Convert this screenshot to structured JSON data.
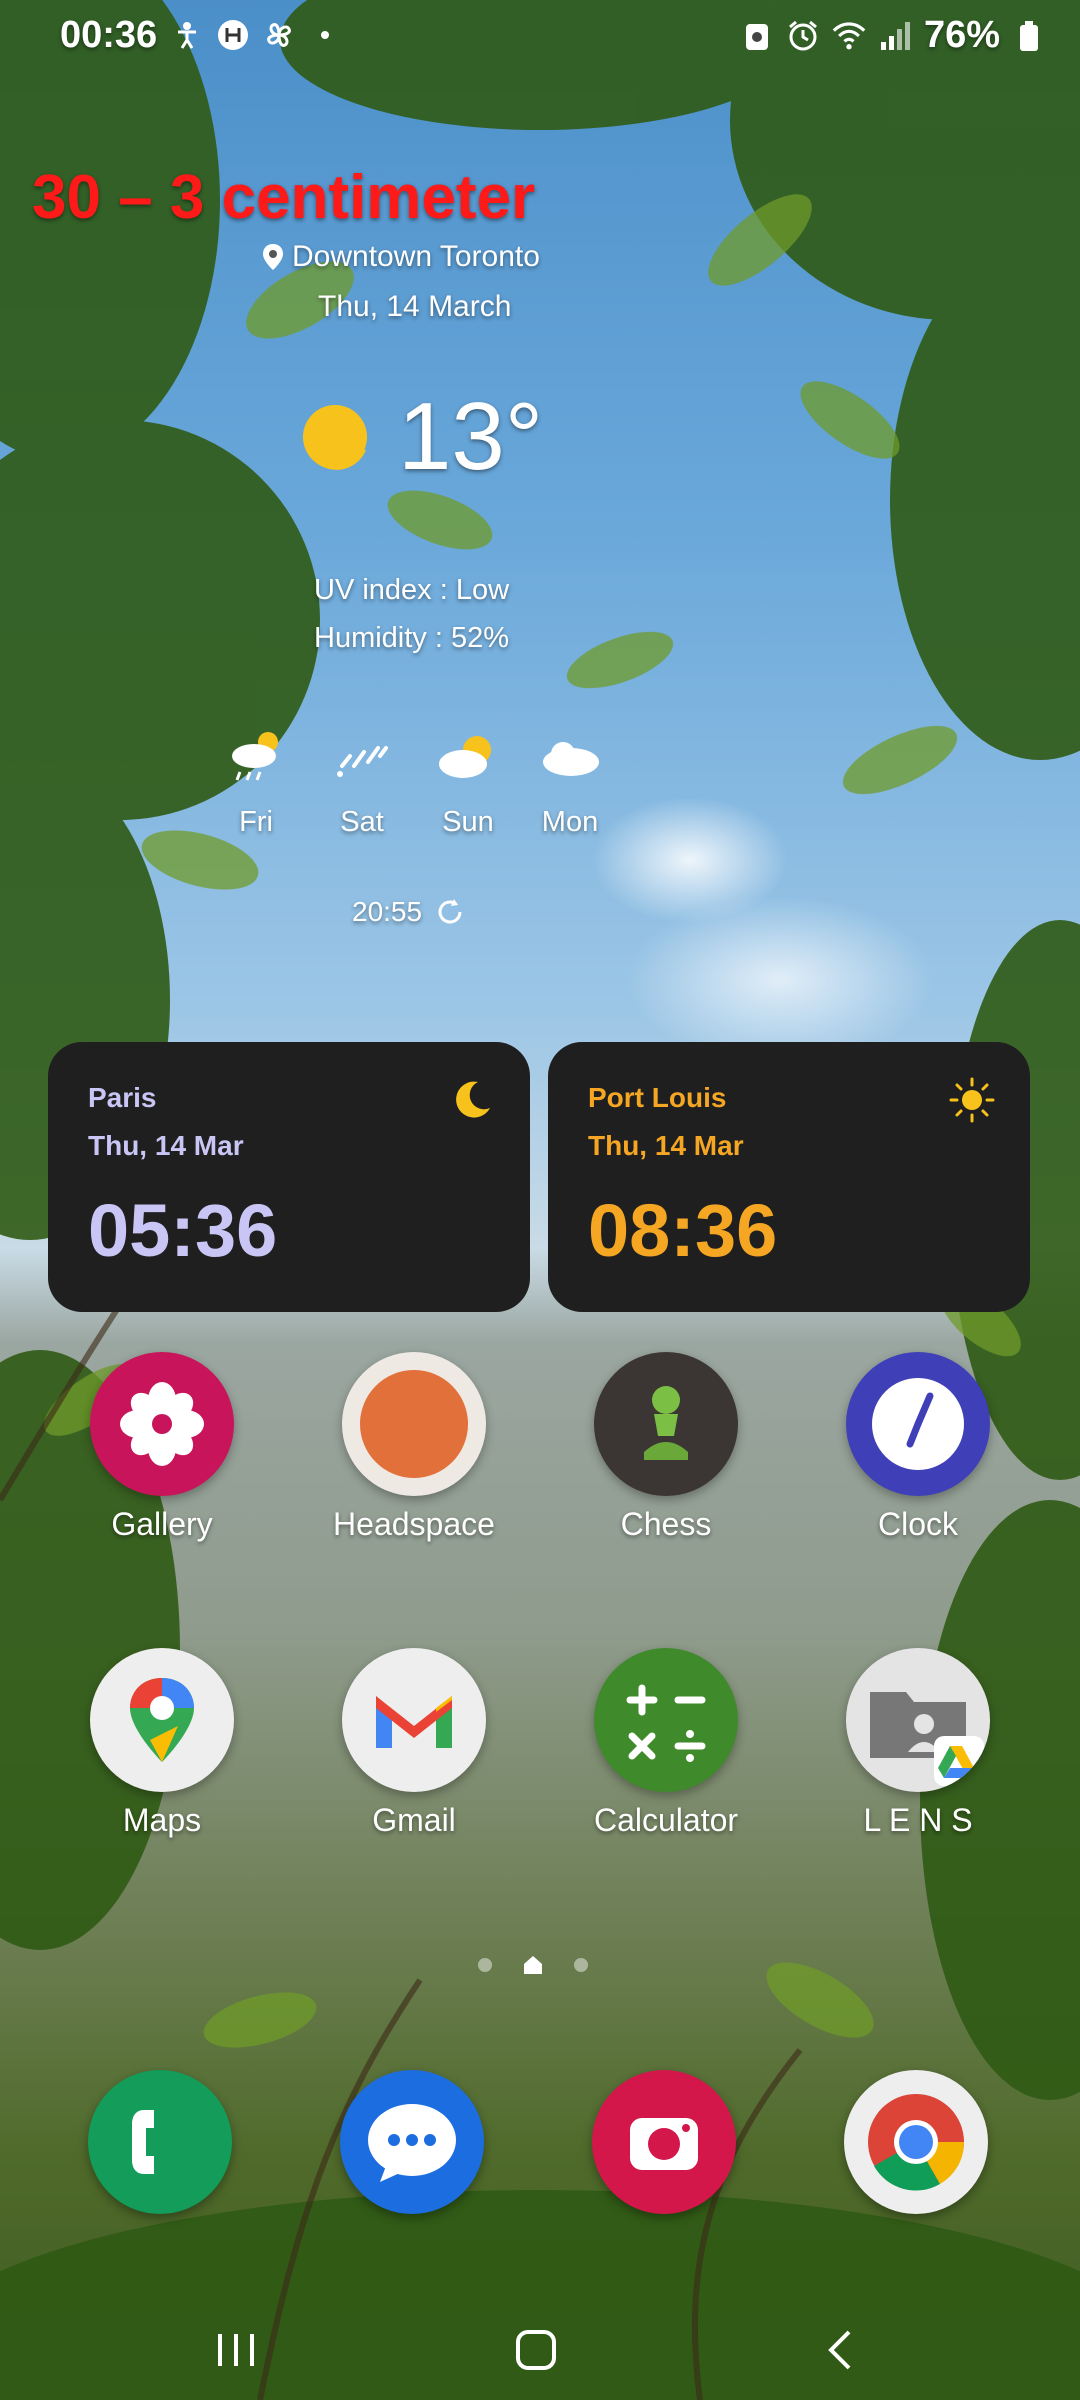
{
  "status_bar": {
    "time": "00:36",
    "battery_percent": "76%",
    "left_icons": [
      "accessibility-icon",
      "hotspot-icon",
      "fan-icon",
      "dot-icon"
    ],
    "right_icons": [
      "alarm-icon",
      "wifi-icon",
      "signal-icon",
      "battery-icon"
    ]
  },
  "weather": {
    "overlay_text": "30 – 3 centimeter",
    "location": "Downtown Toronto",
    "date": "Thu, 14 March",
    "temperature": "13°",
    "uv_index": "UV index : Low",
    "humidity": "Humidity : 52%",
    "forecast": [
      {
        "day": "Fri",
        "icon": "rain-cloud-sun-icon"
      },
      {
        "day": "Sat",
        "icon": "rain-icon"
      },
      {
        "day": "Sun",
        "icon": "partly-sunny-icon"
      },
      {
        "day": "Mon",
        "icon": "cloud-icon"
      }
    ],
    "updated": "20:55"
  },
  "world_clocks": [
    {
      "city": "Paris",
      "date": "Thu, 14 Mar",
      "time": "05:36",
      "accent": "#c9c6f5",
      "icon": "moon-icon"
    },
    {
      "city": "Port Louis",
      "date": "Thu, 14 Mar",
      "time": "08:36",
      "accent": "#f5a623",
      "icon": "sun-icon"
    }
  ],
  "apps": [
    {
      "label": "Gallery"
    },
    {
      "label": "Headspace"
    },
    {
      "label": "Chess"
    },
    {
      "label": "Clock"
    },
    {
      "label": "Maps"
    },
    {
      "label": "Gmail"
    },
    {
      "label": "Calculator"
    },
    {
      "label": "L E N S"
    }
  ],
  "dock": [
    "phone-icon",
    "messages-icon",
    "camera-icon",
    "chrome-icon"
  ],
  "nav": [
    "recents-button",
    "home-button",
    "back-button"
  ]
}
